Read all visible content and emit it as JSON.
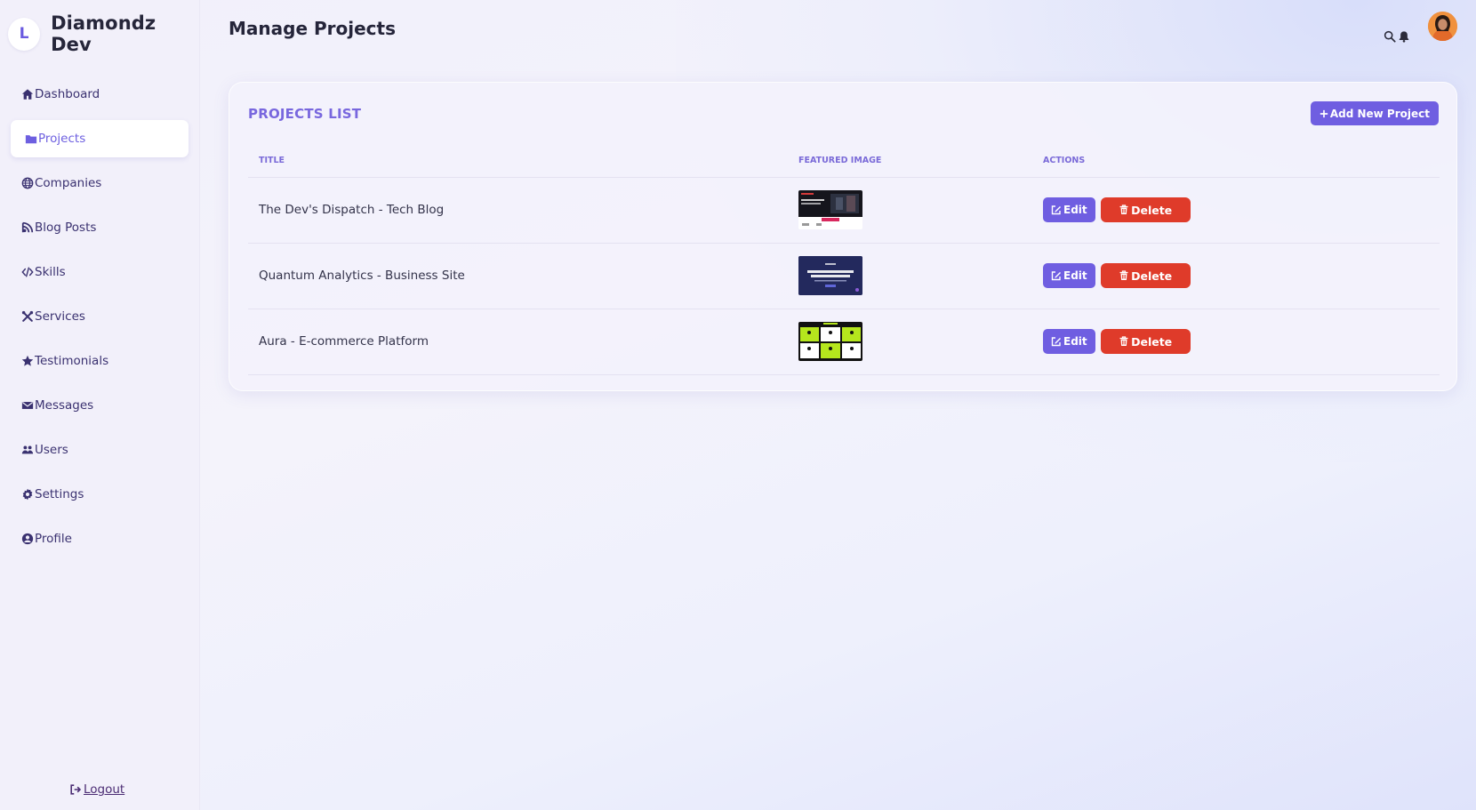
{
  "brand": {
    "logo_letter": "L",
    "name": "Diamondz Dev"
  },
  "sidebar": {
    "items": [
      {
        "label": "Dashboard",
        "icon": "home-icon",
        "active": false
      },
      {
        "label": "Projects",
        "icon": "folder-icon",
        "active": true
      },
      {
        "label": "Companies",
        "icon": "globe-icon",
        "active": false
      },
      {
        "label": "Blog Posts",
        "icon": "blog-icon",
        "active": false
      },
      {
        "label": "Skills",
        "icon": "code-icon",
        "active": false
      },
      {
        "label": "Services",
        "icon": "tools-icon",
        "active": false
      },
      {
        "label": "Testimonials",
        "icon": "star-icon",
        "active": false
      },
      {
        "label": "Messages",
        "icon": "envelope-icon",
        "active": false
      },
      {
        "label": "Users",
        "icon": "users-icon",
        "active": false
      },
      {
        "label": "Settings",
        "icon": "gear-icon",
        "active": false
      },
      {
        "label": "Profile",
        "icon": "user-circle-icon",
        "active": false
      }
    ],
    "logout_label": "Logout"
  },
  "header": {
    "title": "Manage Projects"
  },
  "projects": {
    "section_title": "PROJECTS LIST",
    "add_label": "Add New Project",
    "columns": [
      "TITLE",
      "FEATURED IMAGE",
      "ACTIONS"
    ],
    "rows": [
      {
        "title": "The Dev's Dispatch - Tech Blog",
        "edit": "Edit",
        "delete": "Delete"
      },
      {
        "title": "Quantum Analytics - Business Site",
        "edit": "Edit",
        "delete": "Delete"
      },
      {
        "title": "Aura - E-commerce Platform",
        "edit": "Edit",
        "delete": "Delete"
      }
    ]
  },
  "colors": {
    "accent": "#6f5ee1",
    "danger": "#df3b2a",
    "active_text": "#6d5fe0",
    "nav_text": "#3a3170",
    "lime": "#b5e61d"
  }
}
